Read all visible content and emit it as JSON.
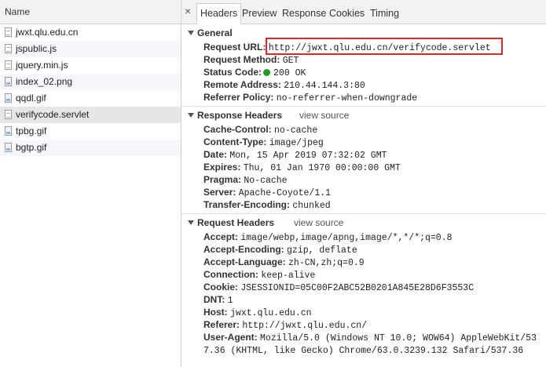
{
  "left": {
    "header": "Name",
    "files": [
      {
        "name": "jwxt.qlu.edu.cn",
        "icon": "document-icon"
      },
      {
        "name": "jspublic.js",
        "icon": "script-file-icon"
      },
      {
        "name": "jquery.min.js",
        "icon": "script-file-icon"
      },
      {
        "name": "index_02.png",
        "icon": "image-file-icon"
      },
      {
        "name": "qqdl.gif",
        "icon": "image-file-icon"
      },
      {
        "name": "verifycode.servlet",
        "icon": "document-icon"
      },
      {
        "name": "tpbg.gif",
        "icon": "image-file-icon"
      },
      {
        "name": "bgtp.gif",
        "icon": "image-file-icon"
      }
    ]
  },
  "tabs": {
    "close": "×",
    "items": [
      "Headers",
      "Preview",
      "Response",
      "Cookies",
      "Timing"
    ],
    "active": "Headers"
  },
  "general": {
    "title": "General",
    "rows": [
      {
        "k": "Request URL:",
        "v": "http://jwxt.qlu.edu.cn/verifycode.servlet"
      },
      {
        "k": "Request Method:",
        "v": "GET"
      },
      {
        "k": "Status Code:",
        "v": "200 OK"
      },
      {
        "k": "Remote Address:",
        "v": "210.44.144.3:80"
      },
      {
        "k": "Referrer Policy:",
        "v": "no-referrer-when-downgrade"
      }
    ],
    "status_color": "#1aa31a"
  },
  "response_headers": {
    "title": "Response Headers",
    "view_source": "view source",
    "rows": [
      {
        "k": "Cache-Control:",
        "v": "no-cache"
      },
      {
        "k": "Content-Type:",
        "v": "image/jpeg"
      },
      {
        "k": "Date:",
        "v": "Mon, 15 Apr 2019 07:32:02 GMT"
      },
      {
        "k": "Expires:",
        "v": "Thu, 01 Jan 1970 00:00:00 GMT"
      },
      {
        "k": "Pragma:",
        "v": "No-cache"
      },
      {
        "k": "Server:",
        "v": "Apache-Coyote/1.1"
      },
      {
        "k": "Transfer-Encoding:",
        "v": "chunked"
      }
    ]
  },
  "request_headers": {
    "title": "Request Headers",
    "view_source": "view source",
    "rows": [
      {
        "k": "Accept:",
        "v": "image/webp,image/apng,image/*,*/*;q=0.8"
      },
      {
        "k": "Accept-Encoding:",
        "v": "gzip, deflate"
      },
      {
        "k": "Accept-Language:",
        "v": "zh-CN,zh;q=0.9"
      },
      {
        "k": "Connection:",
        "v": "keep-alive"
      },
      {
        "k": "Cookie:",
        "v": "JSESSIONID=05C00F2ABC52B0201A845E28D6F3553C"
      },
      {
        "k": "DNT:",
        "v": "1"
      },
      {
        "k": "Host:",
        "v": "jwxt.qlu.edu.cn"
      },
      {
        "k": "Referer:",
        "v": "http://jwxt.qlu.edu.cn/"
      },
      {
        "k": "User-Agent:",
        "v": "Mozilla/5.0 (Windows NT 10.0; WOW64) AppleWebKit/53"
      },
      {
        "k": "",
        "v": "7.36 (KHTML, like Gecko) Chrome/63.0.3239.132 Safari/537.36"
      }
    ]
  },
  "highlight_color": "#e32626"
}
